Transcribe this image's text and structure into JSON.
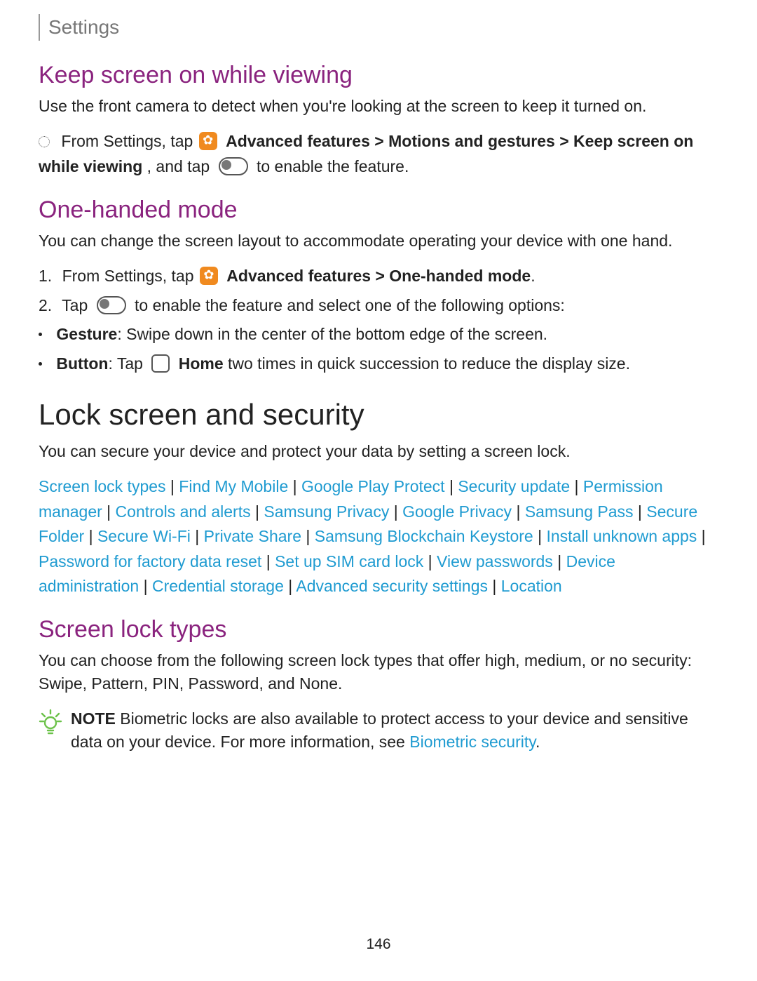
{
  "header": {
    "title": "Settings"
  },
  "keepScreen": {
    "title": "Keep screen on while viewing",
    "desc": "Use the front camera to detect when you're looking at the screen to keep it turned on.",
    "step_prefix": "From Settings, tap",
    "step_bold1": " Advanced features",
    "step_sep1": " > ",
    "step_bold2": "Motions and gestures",
    "step_sep2": " > ",
    "step_bold3": "Keep screen on while viewing",
    "step_mid": ", and tap",
    "step_suffix": "to enable the feature."
  },
  "oneHanded": {
    "title": "One-handed mode",
    "desc": "You can change the screen layout to accommodate operating your device with one hand.",
    "step1_prefix": "From Settings, tap",
    "step1_bold": " Advanced features > One-handed mode",
    "step1_suffix": ".",
    "step2_prefix": "Tap",
    "step2_suffix": "to enable the feature and select one of the following options:",
    "gesture_label": "Gesture",
    "gesture_text": ": Swipe down in the center of the bottom edge of the screen.",
    "button_label": "Button",
    "button_text1": ": Tap",
    "button_bold": " Home",
    "button_text2": " two times in quick succession to reduce the display size."
  },
  "lockSecurity": {
    "title": "Lock screen and security",
    "desc": "You can secure your device and protect your data by setting a screen lock.",
    "links": [
      "Screen lock types",
      "Find My Mobile",
      "Google Play Protect",
      "Security update",
      "Permission manager",
      "Controls and alerts",
      "Samsung Privacy",
      "Google Privacy",
      "Samsung Pass",
      "Secure Folder",
      "Secure Wi-Fi",
      "Private Share",
      "Samsung Blockchain Keystore",
      "Install unknown apps",
      "Password for factory data reset",
      "Set up SIM card lock",
      "View passwords",
      "Device administration",
      "Credential storage",
      "Advanced security settings",
      "Location"
    ],
    "sep": " | "
  },
  "screenLockTypes": {
    "title": "Screen lock types",
    "desc": "You can choose from the following screen lock types that offer high, medium, or no security: Swipe, Pattern, PIN, Password, and None.",
    "note_label": "NOTE",
    "note_text1": "  Biometric locks are also available to protect access to your device and sensitive data on your device. For more information, see ",
    "note_link": "Biometric security",
    "note_text2": "."
  },
  "pageNumber": "146"
}
